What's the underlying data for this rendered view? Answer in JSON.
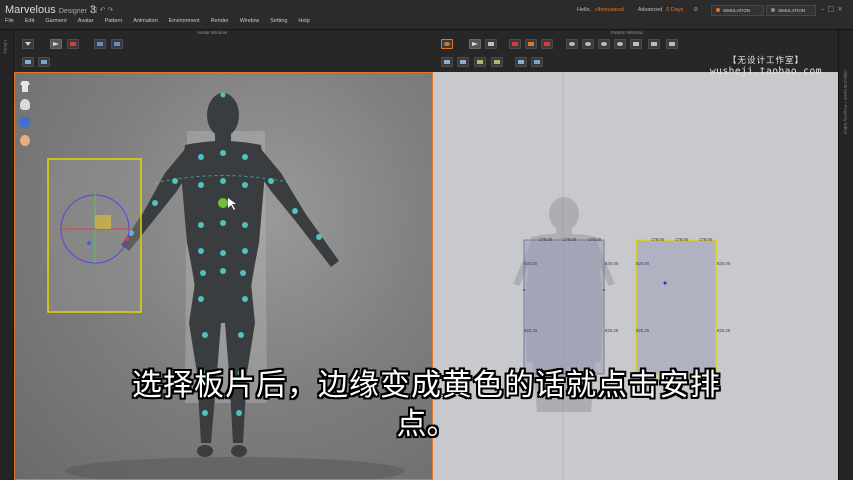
{
  "app": {
    "name": "Marvelous",
    "edition": "Designer",
    "version": "3",
    "menu": [
      "File",
      "Edit",
      "Garment",
      "Avatar",
      "Pattern",
      "Animation",
      "Environment",
      "Render",
      "Window",
      "Setting",
      "Help"
    ],
    "user_greeting": "Hello,",
    "username": "clhoxusiesd",
    "plan": "Advanced",
    "days_left": "0 Days",
    "simulation_button": "SIMULATION",
    "simulation_button_2": "SIMULATION",
    "accent_color": "#e0762b"
  },
  "windows": {
    "avatar_window_title": "Avatar Window",
    "pattern_window_title": "Pattern Window",
    "left_side_label": "Library",
    "right_side_label": "Object Browser / Property Editor"
  },
  "avatar_tools": [
    "shirt-icon",
    "avatar-icon",
    "magnet-icon",
    "face-icon"
  ],
  "pattern": {
    "front": {
      "top_labels": [
        "179.00",
        "179.00",
        "179.00"
      ],
      "side_upper_left": "820.00",
      "side_upper_right": "820.00",
      "side_lower_left": "820.25",
      "side_lower_right": "820.25"
    },
    "back": {
      "top_labels": [
        "179.00",
        "179.00",
        "179.00"
      ],
      "side_upper_left": "820.00",
      "side_upper_right": "820.00",
      "side_lower_left": "820.25",
      "side_lower_right": "820.25"
    },
    "selected_color": "#e8d400"
  },
  "watermark": {
    "line1": "【无设计工作室】",
    "line2": "wusheji.taobao.com"
  },
  "subtitle": {
    "line1": "选择板片后，边缘变成黄色的话就点击安排",
    "line2": "点。"
  }
}
